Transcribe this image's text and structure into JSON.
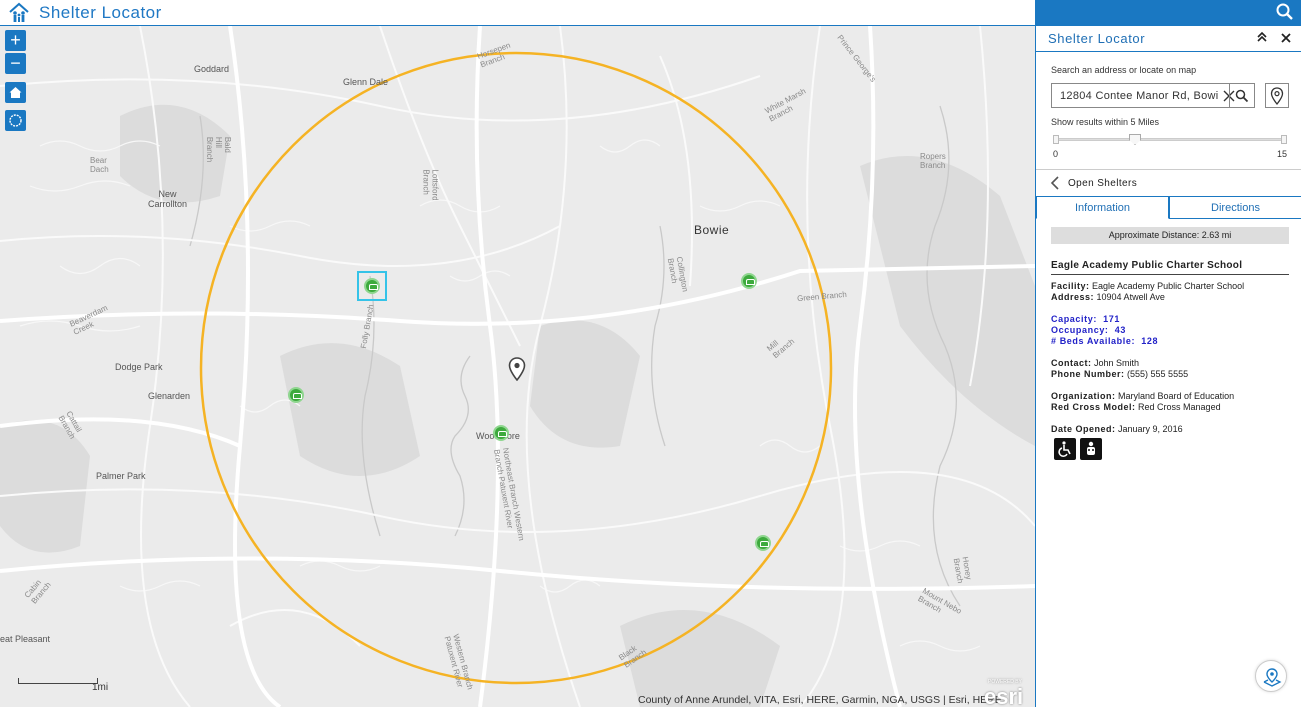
{
  "app": {
    "title": "Shelter Locator",
    "accent_color": "#1a78c2",
    "logo_icon": "family-house-icon"
  },
  "map": {
    "labels": {
      "goddard": "Goddard",
      "glenn_dale": "Glenn Dale",
      "new_carrollton": "New\nCarrollton",
      "bowie": "Bowie",
      "dodge_park": "Dodge Park",
      "glenarden": "Glenarden",
      "woodmore": "Woodmore",
      "palmer_park": "Palmer Park",
      "pleasant": "eat Pleasant",
      "horsepen": "Horsepen\nBranch",
      "white_marsh": "White Marsh\nBranch",
      "prince_georges": "Prince George's",
      "bald_hill": "Bald\nHill\nBranch",
      "lottsford": "Lottsford\nBranch",
      "ropers": "Ropers\nBranch",
      "folly": "Folly Branch",
      "collington": "Collington\nBranch",
      "green_branch": "Green Branch",
      "mill_branch": "Mill\nBranch",
      "beaverdam": "Beaverdam\nCreek",
      "western_branch": "Northeast Branch Western\nBranch Patuxent River",
      "cattail": "Cattail\nBranch",
      "honey": "Honey\nBranch",
      "mount_nebo": "Mount Nebo\nBranch",
      "western_patuxent": "Western Branch\nPatuxent River",
      "black_branch": "Black\nBranch",
      "bear_dach": "Bear\nDach",
      "cabin_branch": "Cabin\nBranch"
    },
    "search_radius_circle_color": "#f5b324",
    "selected_highlight_color": "#35c3e8",
    "shelter_marker_color": "#3daa3d",
    "scale_label": "1mi",
    "attribution": "County of Anne Arundel, VITA, Esri, HERE, Garmin, NGA, USGS | Esri, HERE",
    "esri_logo": "esri",
    "esri_powered": "POWERED BY"
  },
  "map_controls": {
    "zoom_in": "+",
    "zoom_out": "−"
  },
  "panel": {
    "title": "Shelter Locator",
    "search_label": "Search an address or locate on map",
    "search_value": "12804 Contee Manor Rd, Bowie",
    "radius_label": "Show results within 5 Miles",
    "slider_min": "0",
    "slider_max": "15",
    "slider_value": 5,
    "back_label": "Open Shelters",
    "tabs": [
      "Information",
      "Directions"
    ],
    "active_tab": "Information",
    "distance": "Approximate Distance: 2.63 mi",
    "facility_heading": "Eagle Academy Public Charter School",
    "facility_label": "Facility:",
    "facility_value": "Eagle Academy Public Charter School",
    "address_label": "Address:",
    "address_value": "10904 Atwell Ave",
    "capacity_label": "Capacity:",
    "capacity_value": "171",
    "occupancy_label": "Occupancy:",
    "occupancy_value": "43",
    "beds_label": "# Beds Available:",
    "beds_value": "128",
    "contact_label": "Contact:",
    "contact_value": "John Smith",
    "phone_label": "Phone Number:",
    "phone_value": "(555) 555 5555",
    "org_label": "Organization:",
    "org_value": "Maryland Board of Education",
    "model_label": "Red Cross Model:",
    "model_value": "Red Cross Managed",
    "date_label": "Date Opened:",
    "date_value": "January 9, 2016",
    "amenity_icons": [
      "wheelchair-accessible-icon",
      "pet-friendly-icon"
    ]
  }
}
